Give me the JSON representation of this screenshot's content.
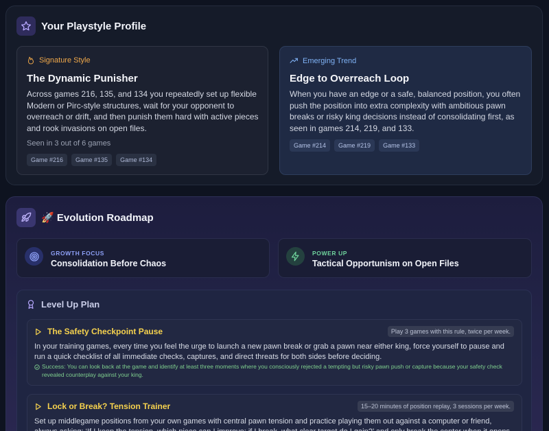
{
  "profile": {
    "title": "Your Playstyle Profile",
    "signature": {
      "tag": "Signature Style",
      "title": "The Dynamic Punisher",
      "body": "Across games 216, 135, and 134 you repeatedly set up flexible Modern or Pirc-style structures, wait for your opponent to overreach or drift, and then punish them hard with active pieces and rook invasions on open files.",
      "seen": "Seen in 3 out of 6 games",
      "games": [
        "Game #216",
        "Game #135",
        "Game #134"
      ]
    },
    "trend": {
      "tag": "Emerging Trend",
      "title": "Edge to Overreach Loop",
      "body": "When you have an edge or a safe, balanced position, you often push the position into extra complexity with ambitious pawn breaks or risky king decisions instead of consolidating first, as seen in games 214, 219, and 133.",
      "games": [
        "Game #214",
        "Game #219",
        "Game #133"
      ]
    }
  },
  "roadmap": {
    "title": "🚀 Evolution Roadmap",
    "growth": {
      "label": "GROWTH FOCUS",
      "title": "Consolidation Before Chaos"
    },
    "power": {
      "label": "POWER UP",
      "title": "Tactical Opportunism on Open Files"
    },
    "level_up": {
      "title": "Level Up Plan",
      "tasks": [
        {
          "title": "The Safety Checkpoint Pause",
          "badge": "Play 3 games with this rule, twice per week.",
          "body": "In your training games, every time you feel the urge to launch a new pawn break or grab a pawn near either king, force yourself to pause and run a quick checklist of all immediate checks, captures, and direct threats for both sides before deciding.",
          "success": "Success: You can look back at the game and identify at least three moments where you consciously rejected a tempting but risky pawn push or capture because your safety check revealed counterplay against your king."
        },
        {
          "title": "Lock or Break? Tension Trainer",
          "badge": "15–20 minutes of position replay, 3 sessions per week.",
          "body": "Set up middlegame positions from your own games with central pawn tension and practice playing them out against a computer or friend, always asking: ‘If I keep the tension, which piece can I improve; if I break, what clear target do I gain?’ and only break the center when it opens lines for your more active pieces."
        }
      ]
    }
  },
  "colors": {
    "signature_accent": "#f0a84a",
    "trend_accent": "#7fb2f5",
    "growth_accent": "#8ea0f7",
    "power_accent": "#6fd39c",
    "task_title": "#f6d24e",
    "success": "#7fcf8e"
  },
  "icons": {
    "profile": "star-icon",
    "signature": "flame-icon",
    "trend": "trending-up-icon",
    "roadmap": "rocket-icon",
    "growth": "target-icon",
    "power": "lightning-icon",
    "level_up": "award-icon",
    "task": "play-triangle-icon",
    "success": "check-circle-icon"
  }
}
